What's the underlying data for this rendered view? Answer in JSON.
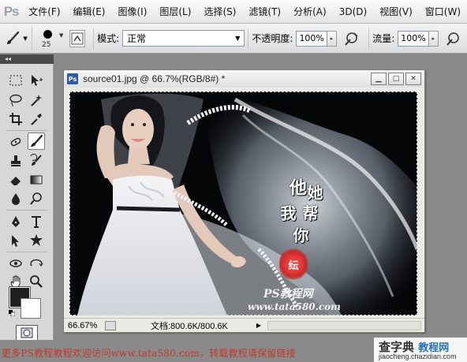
{
  "app": {
    "logo": "Ps"
  },
  "menu": {
    "items": [
      "文件(F)",
      "编辑(E)",
      "图像(I)",
      "图层(L)",
      "选择(S)",
      "滤镜(T)",
      "分析(A)",
      "3D(D)",
      "视图(V)",
      "窗口(W)"
    ]
  },
  "options": {
    "brush_size": "25",
    "mode_label": "模式:",
    "mode_value": "正常",
    "opacity_label": "不透明度:",
    "opacity_value": "100%",
    "flow_label": "流量:",
    "flow_value": "100%"
  },
  "toolpanel": {
    "collapse": "◂◂"
  },
  "document": {
    "title": "source01.jpg @ 66.7%(RGB/8#) *",
    "zoom": "66.67%",
    "doc_size": "文档:800.6K/800.6K",
    "calligraphy": [
      "他",
      "她",
      "我",
      "帮",
      "你"
    ],
    "seal_text": "纭",
    "watermark_1": "PS教程网",
    "watermark_2": "www.tata580.com"
  },
  "colors": {
    "foreground": "#1e1e1e",
    "background": "#ffffff",
    "accent_red": "#c0392b"
  },
  "footer": {
    "text": "更多PS教程教程欢迎访问www.tata580.com，转载教程请保留链接",
    "brand_main_1": "查字典",
    "brand_main_2": "教程网",
    "brand_url": "jiaocheng.chazidian.com"
  }
}
